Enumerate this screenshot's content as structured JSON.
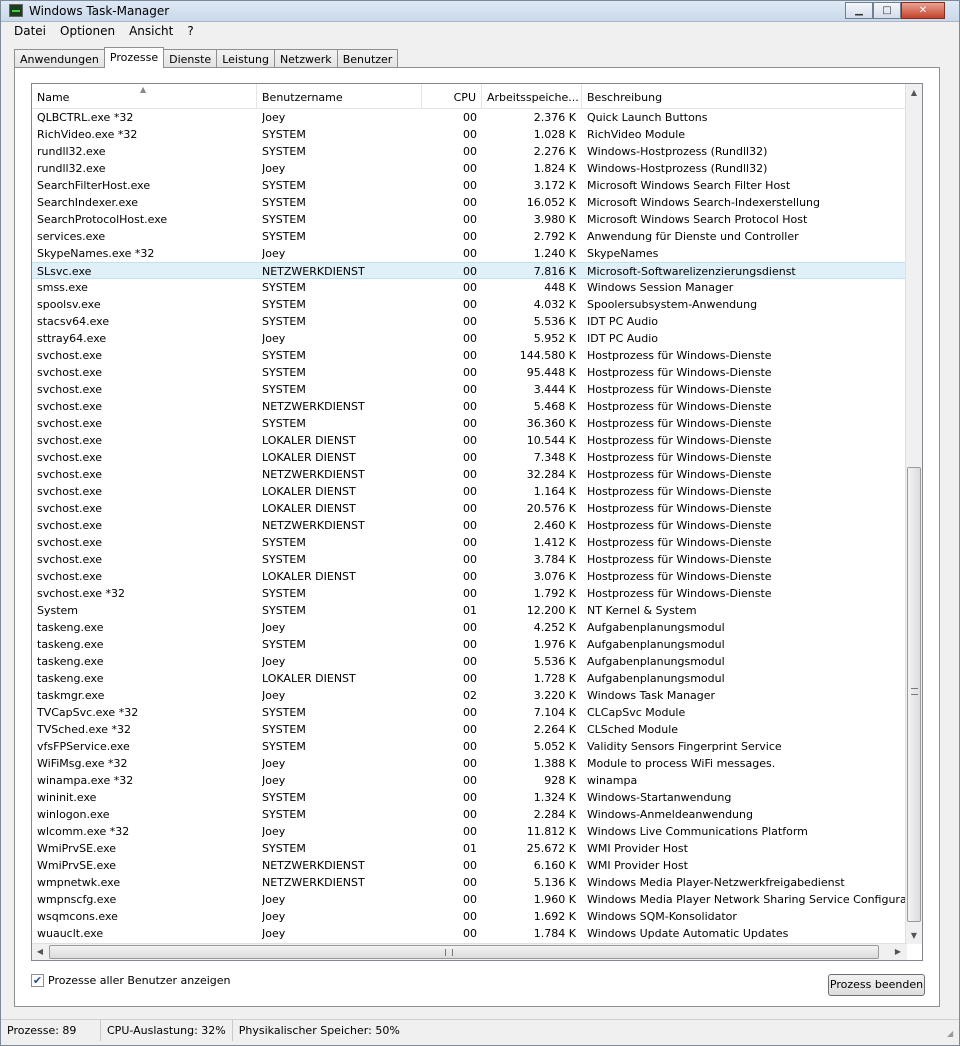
{
  "window": {
    "title": "Windows Task-Manager",
    "minimize": "▁",
    "maximize": "□",
    "close": "✕"
  },
  "menu": [
    "Datei",
    "Optionen",
    "Ansicht",
    "?"
  ],
  "tabs": [
    "Anwendungen",
    "Prozesse",
    "Dienste",
    "Leistung",
    "Netzwerk",
    "Benutzer"
  ],
  "active_tab": "Prozesse",
  "columns": {
    "name": "Name",
    "user": "Benutzername",
    "cpu": "CPU",
    "mem": "Arbeitsspeiche...",
    "desc": "Beschreibung"
  },
  "selected_row": "SLsvc.exe",
  "processes": [
    {
      "name": "QLBCTRL.exe *32",
      "user": "Joey",
      "cpu": "00",
      "mem": "2.376 K",
      "desc": "Quick Launch Buttons"
    },
    {
      "name": "RichVideo.exe *32",
      "user": "SYSTEM",
      "cpu": "00",
      "mem": "1.028 K",
      "desc": "RichVideo Module"
    },
    {
      "name": "rundll32.exe",
      "user": "SYSTEM",
      "cpu": "00",
      "mem": "2.276 K",
      "desc": "Windows-Hostprozess (Rundll32)"
    },
    {
      "name": "rundll32.exe",
      "user": "Joey",
      "cpu": "00",
      "mem": "1.824 K",
      "desc": "Windows-Hostprozess (Rundll32)"
    },
    {
      "name": "SearchFilterHost.exe",
      "user": "SYSTEM",
      "cpu": "00",
      "mem": "3.172 K",
      "desc": "Microsoft Windows Search Filter Host"
    },
    {
      "name": "SearchIndexer.exe",
      "user": "SYSTEM",
      "cpu": "00",
      "mem": "16.052 K",
      "desc": "Microsoft Windows Search-Indexerstellung"
    },
    {
      "name": "SearchProtocolHost.exe",
      "user": "SYSTEM",
      "cpu": "00",
      "mem": "3.980 K",
      "desc": "Microsoft Windows Search Protocol Host"
    },
    {
      "name": "services.exe",
      "user": "SYSTEM",
      "cpu": "00",
      "mem": "2.792 K",
      "desc": "Anwendung für Dienste und Controller"
    },
    {
      "name": "SkypeNames.exe *32",
      "user": "Joey",
      "cpu": "00",
      "mem": "1.240 K",
      "desc": "SkypeNames"
    },
    {
      "name": "SLsvc.exe",
      "user": "NETZWERKDIENST",
      "cpu": "00",
      "mem": "7.816 K",
      "desc": "Microsoft-Softwarelizenzierungsdienst"
    },
    {
      "name": "smss.exe",
      "user": "SYSTEM",
      "cpu": "00",
      "mem": "448 K",
      "desc": "Windows Session Manager"
    },
    {
      "name": "spoolsv.exe",
      "user": "SYSTEM",
      "cpu": "00",
      "mem": "4.032 K",
      "desc": "Spoolersubsystem-Anwendung"
    },
    {
      "name": "stacsv64.exe",
      "user": "SYSTEM",
      "cpu": "00",
      "mem": "5.536 K",
      "desc": "IDT PC Audio"
    },
    {
      "name": "sttray64.exe",
      "user": "Joey",
      "cpu": "00",
      "mem": "5.952 K",
      "desc": "IDT PC Audio"
    },
    {
      "name": "svchost.exe",
      "user": "SYSTEM",
      "cpu": "00",
      "mem": "144.580 K",
      "desc": "Hostprozess für Windows-Dienste"
    },
    {
      "name": "svchost.exe",
      "user": "SYSTEM",
      "cpu": "00",
      "mem": "95.448 K",
      "desc": "Hostprozess für Windows-Dienste"
    },
    {
      "name": "svchost.exe",
      "user": "SYSTEM",
      "cpu": "00",
      "mem": "3.444 K",
      "desc": "Hostprozess für Windows-Dienste"
    },
    {
      "name": "svchost.exe",
      "user": "NETZWERKDIENST",
      "cpu": "00",
      "mem": "5.468 K",
      "desc": "Hostprozess für Windows-Dienste"
    },
    {
      "name": "svchost.exe",
      "user": "SYSTEM",
      "cpu": "00",
      "mem": "36.360 K",
      "desc": "Hostprozess für Windows-Dienste"
    },
    {
      "name": "svchost.exe",
      "user": "LOKALER DIENST",
      "cpu": "00",
      "mem": "10.544 K",
      "desc": "Hostprozess für Windows-Dienste"
    },
    {
      "name": "svchost.exe",
      "user": "LOKALER DIENST",
      "cpu": "00",
      "mem": "7.348 K",
      "desc": "Hostprozess für Windows-Dienste"
    },
    {
      "name": "svchost.exe",
      "user": "NETZWERKDIENST",
      "cpu": "00",
      "mem": "32.284 K",
      "desc": "Hostprozess für Windows-Dienste"
    },
    {
      "name": "svchost.exe",
      "user": "LOKALER DIENST",
      "cpu": "00",
      "mem": "1.164 K",
      "desc": "Hostprozess für Windows-Dienste"
    },
    {
      "name": "svchost.exe",
      "user": "LOKALER DIENST",
      "cpu": "00",
      "mem": "20.576 K",
      "desc": "Hostprozess für Windows-Dienste"
    },
    {
      "name": "svchost.exe",
      "user": "NETZWERKDIENST",
      "cpu": "00",
      "mem": "2.460 K",
      "desc": "Hostprozess für Windows-Dienste"
    },
    {
      "name": "svchost.exe",
      "user": "SYSTEM",
      "cpu": "00",
      "mem": "1.412 K",
      "desc": "Hostprozess für Windows-Dienste"
    },
    {
      "name": "svchost.exe",
      "user": "SYSTEM",
      "cpu": "00",
      "mem": "3.784 K",
      "desc": "Hostprozess für Windows-Dienste"
    },
    {
      "name": "svchost.exe",
      "user": "LOKALER DIENST",
      "cpu": "00",
      "mem": "3.076 K",
      "desc": "Hostprozess für Windows-Dienste"
    },
    {
      "name": "svchost.exe *32",
      "user": "SYSTEM",
      "cpu": "00",
      "mem": "1.792 K",
      "desc": "Hostprozess für Windows-Dienste"
    },
    {
      "name": "System",
      "user": "SYSTEM",
      "cpu": "01",
      "mem": "12.200 K",
      "desc": "NT Kernel & System"
    },
    {
      "name": "taskeng.exe",
      "user": "Joey",
      "cpu": "00",
      "mem": "4.252 K",
      "desc": "Aufgabenplanungsmodul"
    },
    {
      "name": "taskeng.exe",
      "user": "SYSTEM",
      "cpu": "00",
      "mem": "1.976 K",
      "desc": "Aufgabenplanungsmodul"
    },
    {
      "name": "taskeng.exe",
      "user": "Joey",
      "cpu": "00",
      "mem": "5.536 K",
      "desc": "Aufgabenplanungsmodul"
    },
    {
      "name": "taskeng.exe",
      "user": "LOKALER DIENST",
      "cpu": "00",
      "mem": "1.728 K",
      "desc": "Aufgabenplanungsmodul"
    },
    {
      "name": "taskmgr.exe",
      "user": "Joey",
      "cpu": "02",
      "mem": "3.220 K",
      "desc": "Windows Task Manager"
    },
    {
      "name": "TVCapSvc.exe *32",
      "user": "SYSTEM",
      "cpu": "00",
      "mem": "7.104 K",
      "desc": "CLCapSvc Module"
    },
    {
      "name": "TVSched.exe *32",
      "user": "SYSTEM",
      "cpu": "00",
      "mem": "2.264 K",
      "desc": "CLSched Module"
    },
    {
      "name": "vfsFPService.exe",
      "user": "SYSTEM",
      "cpu": "00",
      "mem": "5.052 K",
      "desc": "Validity Sensors Fingerprint Service"
    },
    {
      "name": "WiFiMsg.exe *32",
      "user": "Joey",
      "cpu": "00",
      "mem": "1.388 K",
      "desc": "Module to process WiFi messages."
    },
    {
      "name": "winampa.exe *32",
      "user": "Joey",
      "cpu": "00",
      "mem": "928 K",
      "desc": "winampa"
    },
    {
      "name": "wininit.exe",
      "user": "SYSTEM",
      "cpu": "00",
      "mem": "1.324 K",
      "desc": "Windows-Startanwendung"
    },
    {
      "name": "winlogon.exe",
      "user": "SYSTEM",
      "cpu": "00",
      "mem": "2.284 K",
      "desc": "Windows-Anmeldeanwendung"
    },
    {
      "name": "wlcomm.exe *32",
      "user": "Joey",
      "cpu": "00",
      "mem": "11.812 K",
      "desc": "Windows Live Communications Platform"
    },
    {
      "name": "WmiPrvSE.exe",
      "user": "SYSTEM",
      "cpu": "01",
      "mem": "25.672 K",
      "desc": "WMI Provider Host"
    },
    {
      "name": "WmiPrvSE.exe",
      "user": "NETZWERKDIENST",
      "cpu": "00",
      "mem": "6.160 K",
      "desc": "WMI Provider Host"
    },
    {
      "name": "wmpnetwk.exe",
      "user": "NETZWERKDIENST",
      "cpu": "00",
      "mem": "5.136 K",
      "desc": "Windows Media Player-Netzwerkfreigabedienst"
    },
    {
      "name": "wmpnscfg.exe",
      "user": "Joey",
      "cpu": "00",
      "mem": "1.960 K",
      "desc": "Windows Media Player Network Sharing Service Configuration Appl"
    },
    {
      "name": "wsqmcons.exe",
      "user": "Joey",
      "cpu": "00",
      "mem": "1.692 K",
      "desc": "Windows SQM-Konsolidator"
    },
    {
      "name": "wuauclt.exe",
      "user": "Joey",
      "cpu": "00",
      "mem": "1.784 K",
      "desc": "Windows Update Automatic Updates"
    }
  ],
  "show_all_users": {
    "label": "Prozesse aller Benutzer anzeigen",
    "checked": true
  },
  "end_process_button": "Prozess beenden",
  "status": {
    "processes": "Prozesse: 89",
    "cpu": "CPU-Auslastung: 32%",
    "memory": "Physikalischer Speicher: 50%"
  }
}
